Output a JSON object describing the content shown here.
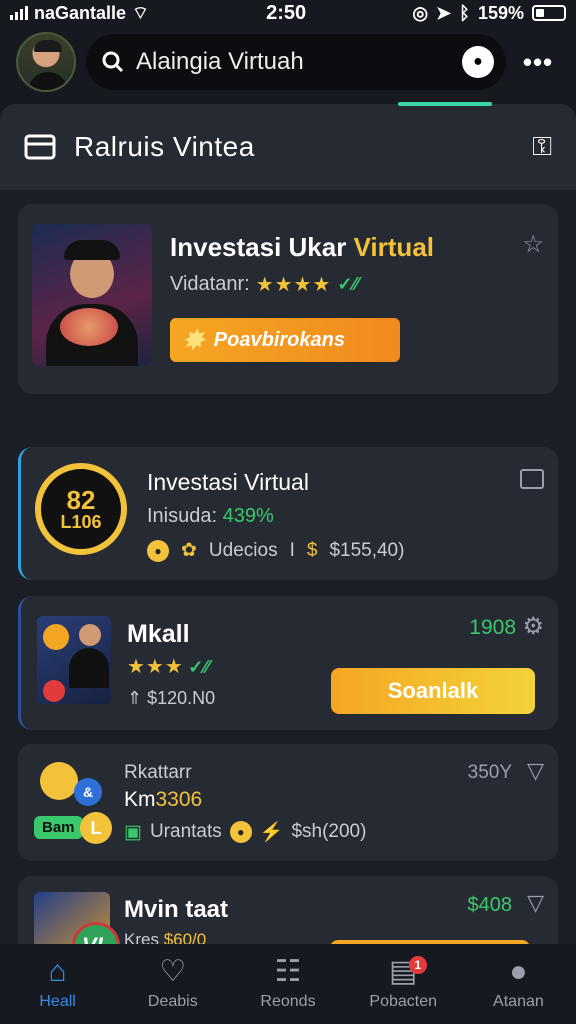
{
  "status_bar": {
    "carrier": "naGantalle",
    "time": "2:50",
    "battery": "159%"
  },
  "search": {
    "value": "Alaingia Virtuah"
  },
  "panel_header": {
    "title": "Ralruis Vintea"
  },
  "featured": {
    "title_part1": "Investasi Ukar ",
    "title_part2": "Virtual",
    "subtitle": "Vidatanr:",
    "stars": "★★★★",
    "check": "✓⁄⁄",
    "button_label": "Poavbirokans"
  },
  "card2": {
    "badge_top": "82",
    "badge_bottom": "L106",
    "title": "Investasi Virtual",
    "subtitle_label": "Inisuda: ",
    "subtitle_value": "439%",
    "meta_label": "Udecios",
    "meta_sep": "I",
    "meta_price": "$155,40)"
  },
  "card3": {
    "title": "Mkall",
    "stars": "★★★",
    "check": "✓⁄⁄",
    "price": "$120.​N0",
    "value": "1908",
    "button_label": "Soanlalk"
  },
  "card4": {
    "title": "Rkattarr",
    "subtitle_prefix": "Km",
    "subtitle_value": "3306",
    "tag_label": "Bam",
    "tag_coin": "L",
    "meta_label": "Urantats",
    "meta_price": "$sh(200)",
    "value": "350Y"
  },
  "card5": {
    "title": "Mvin taat",
    "subtitle_prefix": "Kres ",
    "subtitle_value": "$60/0",
    "value": "$408"
  },
  "fab": {
    "label": "VL"
  },
  "nav": {
    "items": [
      {
        "label": "Heall",
        "icon": "home-icon"
      },
      {
        "label": "Deabis",
        "icon": "heart-icon"
      },
      {
        "label": "Reonds",
        "icon": "list-icon"
      },
      {
        "label": "Pobacten",
        "icon": "bag-icon",
        "badge": "1"
      },
      {
        "label": "Atanan",
        "icon": "user-icon"
      }
    ]
  },
  "colors": {
    "accent": "#2f8fe6",
    "gold": "#f2c23a",
    "green": "#39c96b",
    "orange": "#f5a623",
    "panel": "#262a33"
  }
}
